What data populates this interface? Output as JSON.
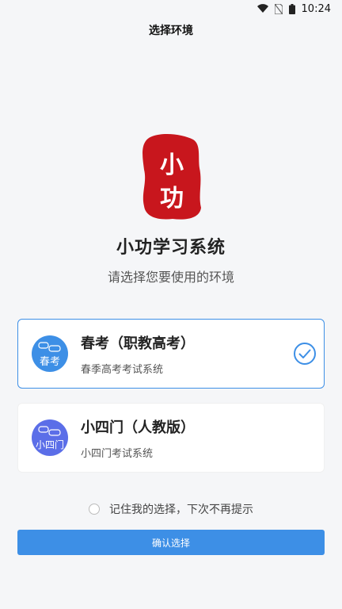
{
  "status_bar": {
    "time": "10:24",
    "icons": [
      "wifi-icon",
      "no-sim-icon",
      "battery-icon"
    ]
  },
  "header": {
    "title": "选择环境"
  },
  "app": {
    "name": "小功学习系统",
    "subtitle": "请选择您要使用的环境",
    "logo_text": "小功"
  },
  "options": [
    {
      "name": "春考（职教高考）",
      "desc": "春季高考考试系统",
      "avatar_text": "春考",
      "avatar_color": "#3d8fe6",
      "selected": true
    },
    {
      "name": "小四门（人教版）",
      "desc": "小四门考试系统",
      "avatar_text": "小四门",
      "avatar_color": "#5b6ee8",
      "selected": false
    }
  ],
  "remember": {
    "label": "记住我的选择，下次不再提示",
    "checked": false
  },
  "confirm_button": {
    "label": "确认选择"
  },
  "colors": {
    "accent": "#3d8fe6",
    "seal_red": "#c8161d"
  }
}
